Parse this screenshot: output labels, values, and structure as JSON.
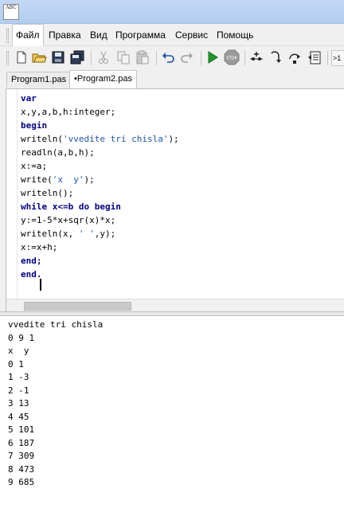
{
  "titlebar": {
    "icon_text": "ABC"
  },
  "menu": [
    {
      "label": "Файл",
      "active": true
    },
    {
      "label": "Правка"
    },
    {
      "label": "Вид"
    },
    {
      "label": "Программа"
    },
    {
      "label": "Сервис"
    },
    {
      "label": "Помощь"
    }
  ],
  "toolbar": {
    "buttons": [
      "new-file-icon",
      "open-folder-icon",
      "save-icon",
      "save-all-icon",
      "cut-icon",
      "copy-icon",
      "paste-icon",
      "undo-icon",
      "redo-icon",
      "run-icon",
      "stop-icon",
      "debug-icon",
      "step-into-icon",
      "step-over-icon",
      "watch-icon"
    ],
    "overflow_label": ">1"
  },
  "tabs": [
    {
      "label": "Program1.pas"
    },
    {
      "label": "•Program2.pas",
      "active": true
    }
  ],
  "editor": {
    "lines": [
      "var",
      "x,y,a,b,h:integer;",
      "begin",
      "writeln('vvedite tri chisla');",
      "readln(a,b,h);",
      "x:=a;",
      "write('x  y');",
      "writeln();",
      "while x<=b do begin",
      "y:=1-5*x+sqr(x)*x;",
      "writeln(x, ' ',y);",
      "x:=x+h;",
      "end;",
      "end."
    ]
  },
  "output": {
    "lines": [
      "vvedite tri chisla",
      "0 9 1",
      "x  y",
      "0 1",
      "1 -3",
      "2 -1",
      "3 13",
      "4 45",
      "5 101",
      "6 187",
      "7 309",
      "8 473",
      "9 685"
    ]
  },
  "colors": {
    "keyword": "#000080",
    "string": "#1f56a8",
    "run": "#1f9a2c",
    "stop": "#9b9b9b"
  }
}
